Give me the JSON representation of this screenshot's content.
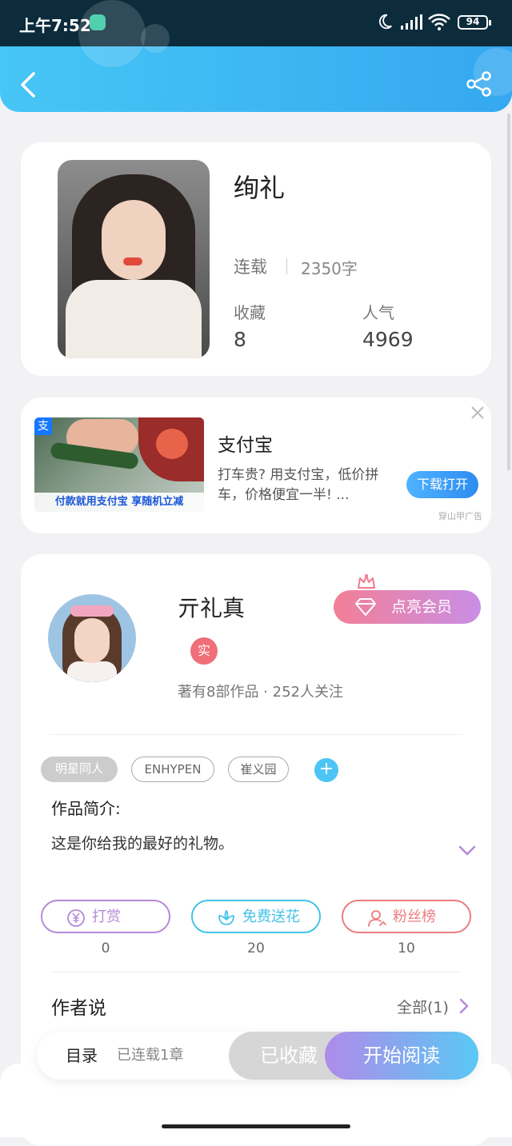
{
  "status_bar": {
    "time": "上午7:52",
    "battery": "94",
    "icons": [
      "moon-icon",
      "signal-icon",
      "wifi-icon",
      "battery-icon"
    ]
  },
  "header": {
    "back_icon": "chevron-left-icon",
    "share_icon": "share-icon"
  },
  "book": {
    "title": "绚礼",
    "status": "连载",
    "words": "2350字",
    "favorites_label": "收藏",
    "favorites_value": "8",
    "popularity_label": "人气",
    "popularity_value": "4969"
  },
  "ad": {
    "brand": "支付宝",
    "image_logo": "支",
    "image_banner": "付款就用支付宝 享随机立减",
    "description": "打车贵? 用支付宝，低价拼车，价格便宜一半! ...",
    "cta": "下载打开",
    "source": "穿山甲广告"
  },
  "author": {
    "name": "亓礼真",
    "verified_badge": "实",
    "meta": "著有8部作品 · 252人关注",
    "vip_button": "点亮会员"
  },
  "tags": [
    "明星同人",
    "ENHYPEN",
    "崔义园"
  ],
  "intro": {
    "label": "作品简介:",
    "text": "这是你给我的最好的礼物。"
  },
  "actions": [
    {
      "label": "打赏",
      "count": "0",
      "color": "#b58ad9"
    },
    {
      "label": "免费送花",
      "count": "20",
      "color": "#42c3e8"
    },
    {
      "label": "粉丝榜",
      "count": "10",
      "color": "#ec7e7e"
    }
  ],
  "author_says": {
    "label": "作者说",
    "all": "全部(1)"
  },
  "bottom_bar": {
    "toc": "目录",
    "toc_sub": "已连载1章",
    "saved": "已收藏",
    "read": "开始阅读"
  },
  "colors": {
    "header": "#3db8f3",
    "vip": "#f27f96",
    "read_button": "#8fb3ee"
  }
}
